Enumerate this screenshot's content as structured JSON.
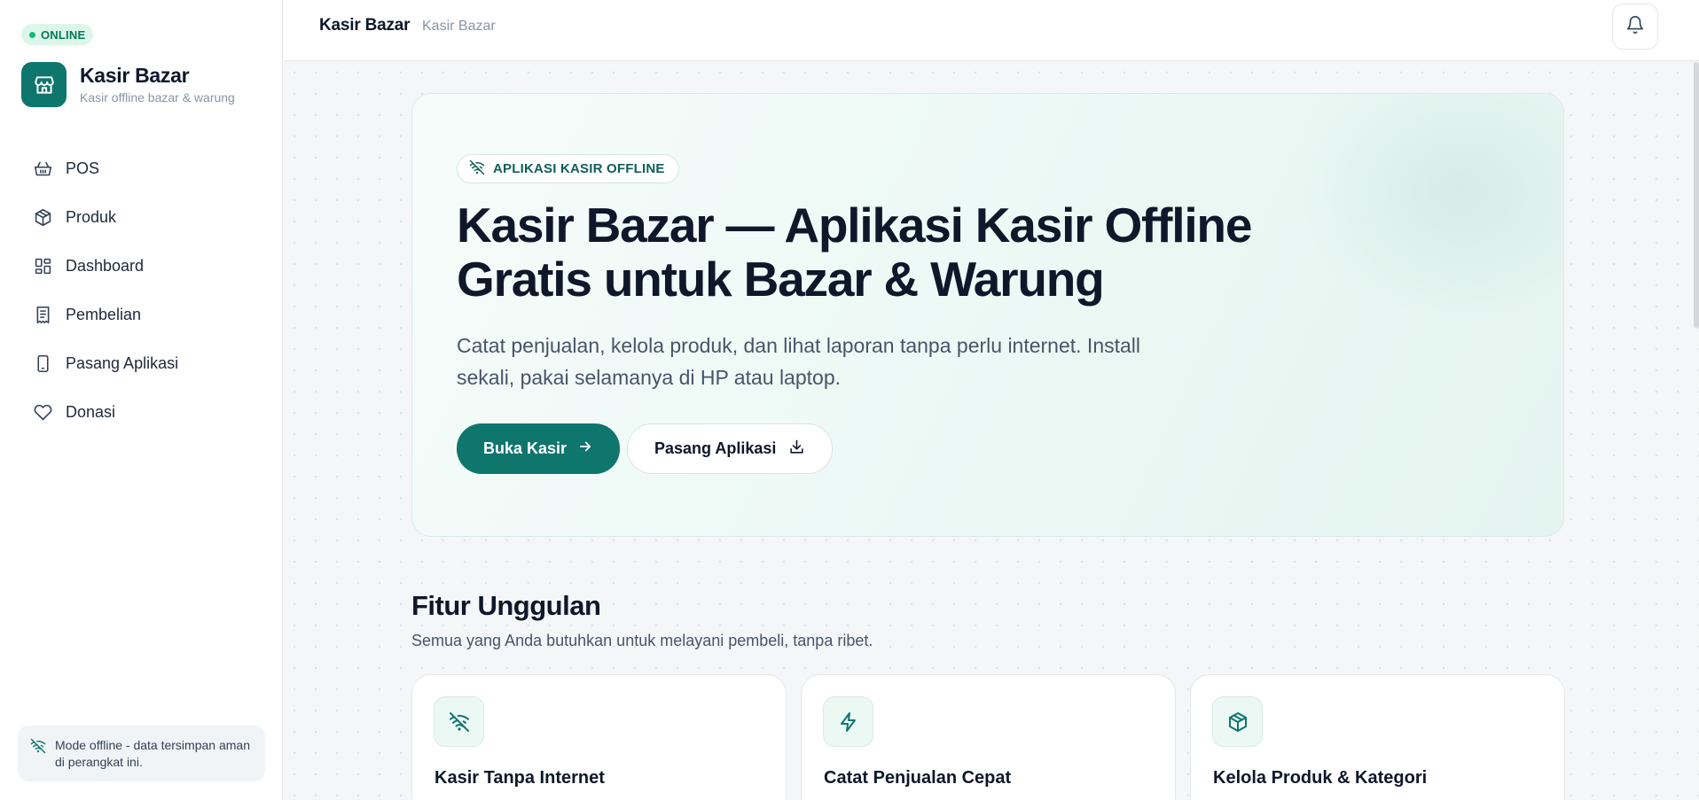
{
  "sidebar": {
    "status": "ONLINE",
    "brand_name": "Kasir Bazar",
    "brand_tagline": "Kasir offline bazar & warung",
    "nav": [
      {
        "label": "POS",
        "icon": "basket-icon"
      },
      {
        "label": "Produk",
        "icon": "box-icon"
      },
      {
        "label": "Dashboard",
        "icon": "dashboard-icon"
      },
      {
        "label": "Pembelian",
        "icon": "receipt-icon"
      },
      {
        "label": "Pasang Aplikasi",
        "icon": "phone-icon"
      },
      {
        "label": "Donasi",
        "icon": "heart-icon"
      }
    ],
    "offline_note": "Mode offline - data tersimpan aman di perangkat ini."
  },
  "topbar": {
    "title": "Kasir Bazar",
    "crumb": "Kasir Bazar"
  },
  "hero": {
    "badge": "APLIKASI KASIR OFFLINE",
    "title": "Kasir Bazar — Aplikasi Kasir Offline Gratis untuk Bazar & Warung",
    "description": "Catat penjualan, kelola produk, dan lihat laporan tanpa perlu internet. Install sekali, pakai selamanya di HP atau laptop.",
    "primary_button": "Buka Kasir",
    "secondary_button": "Pasang Aplikasi"
  },
  "features": {
    "title": "Fitur Unggulan",
    "subtitle": "Semua yang Anda butuhkan untuk melayani pembeli, tanpa ribet.",
    "cards": [
      {
        "title": "Kasir Tanpa Internet",
        "icon": "wifi-off-icon"
      },
      {
        "title": "Catat Penjualan Cepat",
        "icon": "lightning-icon"
      },
      {
        "title": "Kelola Produk & Kategori",
        "icon": "box-icon"
      }
    ]
  },
  "colors": {
    "accent": "#0f766e",
    "online": "#10b981",
    "text": "#0f172a"
  }
}
